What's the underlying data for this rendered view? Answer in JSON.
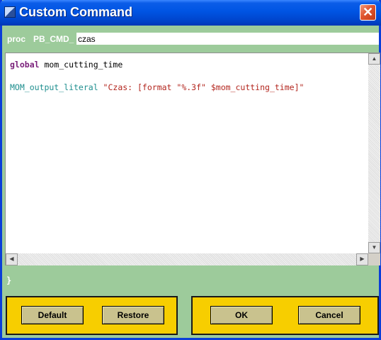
{
  "window": {
    "title": "Custom Command",
    "close_label": "✕"
  },
  "header": {
    "proc_label": "proc",
    "cmd_prefix": "PB_CMD_",
    "proc_name_value": "czas"
  },
  "editor": {
    "line1": {
      "keyword": "global",
      "text": " mom_cutting_time"
    },
    "line2": {
      "command": "MOM_output_literal",
      "string": " \"Czas: [format \"%.3f\" $mom_cutting_time]\""
    }
  },
  "footer": {
    "closing_brace": "}"
  },
  "buttons": {
    "default_label": "Default",
    "restore_label": "Restore",
    "ok_label": "OK",
    "cancel_label": "Cancel"
  },
  "colors": {
    "accent_green": "#9dcb9b",
    "panel_yellow": "#f7ce00",
    "keyword": "#7a1f7a",
    "command": "#1f8f8f",
    "string": "#b3261e"
  }
}
